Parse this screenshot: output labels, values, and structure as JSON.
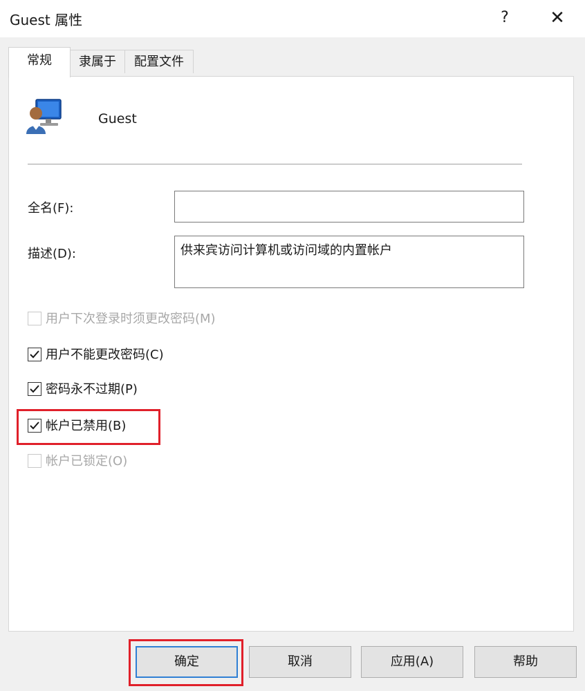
{
  "window": {
    "title": "Guest 属性",
    "help": "?",
    "close": "✕"
  },
  "tabs": [
    {
      "label": "常规",
      "active": true
    },
    {
      "label": "隶属于",
      "active": false
    },
    {
      "label": "配置文件",
      "active": false
    }
  ],
  "user": {
    "name": "Guest"
  },
  "fields": {
    "fullname": {
      "label": "全名(F):",
      "value": ""
    },
    "description": {
      "label": "描述(D):",
      "value": "供来宾访问计算机或访问域的内置帐户"
    }
  },
  "checkboxes": [
    {
      "label": "用户下次登录时须更改密码(M)",
      "checked": false,
      "enabled": false
    },
    {
      "label": "用户不能更改密码(C)",
      "checked": true,
      "enabled": true
    },
    {
      "label": "密码永不过期(P)",
      "checked": true,
      "enabled": true
    },
    {
      "label": "帐户已禁用(B)",
      "checked": true,
      "enabled": true
    },
    {
      "label": "帐户已锁定(O)",
      "checked": false,
      "enabled": false
    }
  ],
  "buttons": {
    "ok": "确定",
    "cancel": "取消",
    "apply": "应用(A)",
    "help": "帮助"
  },
  "colors": {
    "highlight": "#e0202a",
    "default_button_border": "#2f7fd4"
  }
}
